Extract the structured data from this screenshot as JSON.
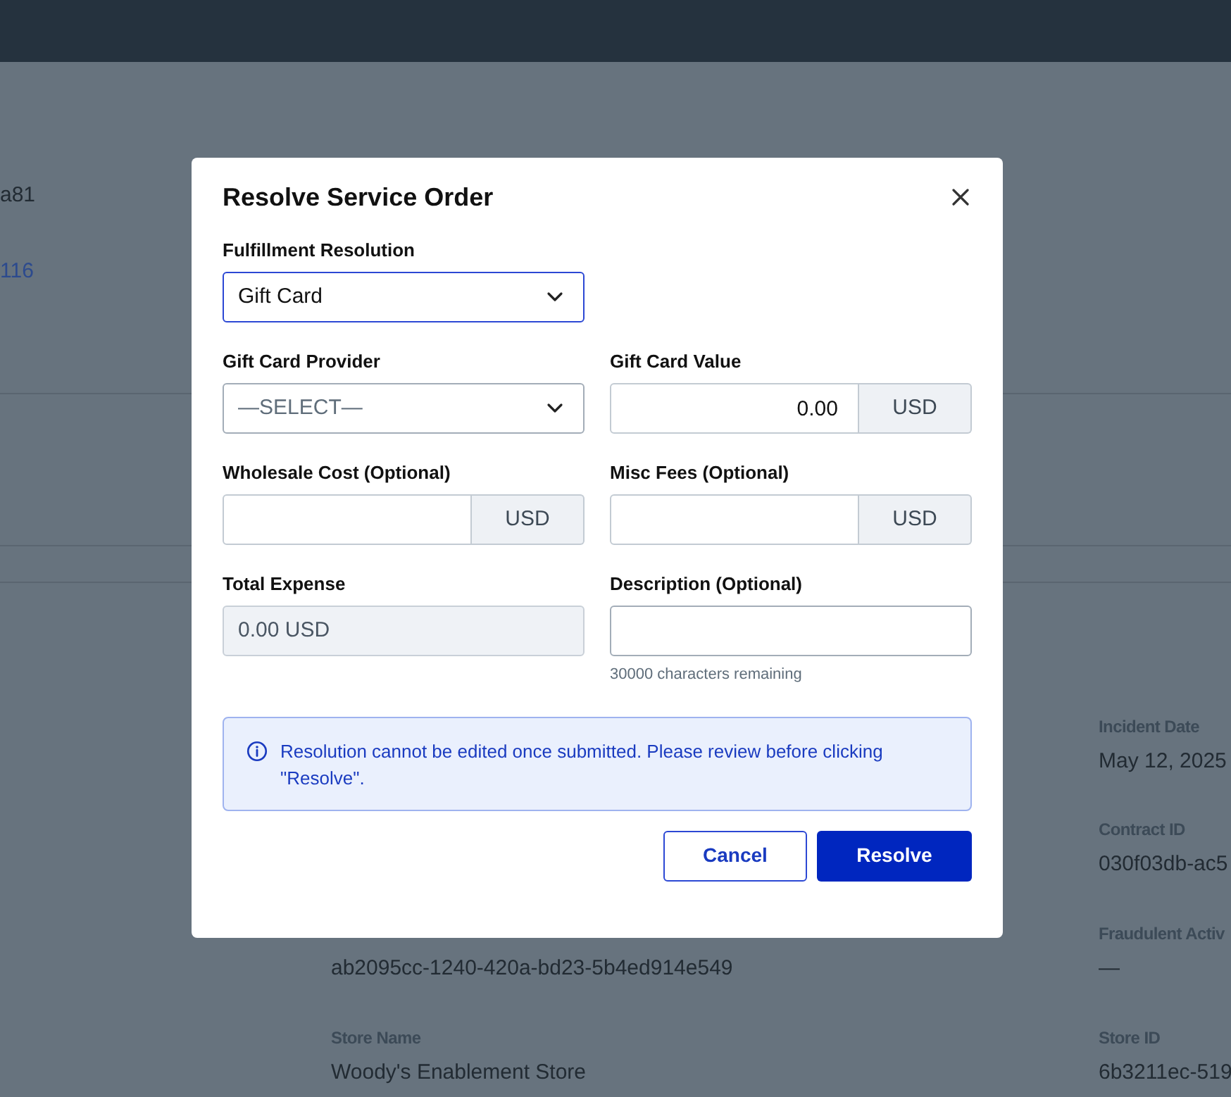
{
  "background": {
    "fragments": [
      {
        "kind": "value",
        "text": "a81"
      },
      {
        "kind": "link",
        "text": "116"
      },
      {
        "kind": "label",
        "text": "Incident Date"
      },
      {
        "kind": "value",
        "text": "May 12, 2025"
      },
      {
        "kind": "label",
        "text": "Contract ID"
      },
      {
        "kind": "value",
        "text": "030f03db-ac5"
      },
      {
        "kind": "label",
        "text": "Fraudulent Activ"
      },
      {
        "kind": "value",
        "text": "—"
      },
      {
        "kind": "value",
        "text": "ab2095cc-1240-420a-bd23-5b4ed914e549"
      },
      {
        "kind": "label",
        "text": "Store Name"
      },
      {
        "kind": "value",
        "text": "Woody's Enablement Store"
      },
      {
        "kind": "label",
        "text": "Store ID"
      },
      {
        "kind": "value",
        "text": "6b3211ec-519"
      }
    ]
  },
  "modal": {
    "title": "Resolve Service Order",
    "rows": [
      [
        {
          "kind": "select",
          "label": "Fulfillment Resolution",
          "value": "Gift Card",
          "focused": true
        }
      ],
      [
        {
          "kind": "select",
          "label": "Gift Card Provider",
          "placeholder": "—SELECT—",
          "focused": false
        },
        {
          "kind": "amount",
          "label": "Gift Card Value",
          "value": "0.00",
          "suffix": "USD"
        }
      ],
      [
        {
          "kind": "amount",
          "label": "Wholesale Cost (Optional)",
          "suffix": "USD"
        },
        {
          "kind": "amount",
          "label": "Misc Fees (Optional)",
          "suffix": "USD"
        }
      ],
      [
        {
          "kind": "readonly",
          "label": "Total Expense",
          "value": "0.00 USD"
        },
        {
          "kind": "text",
          "label": "Description (Optional)",
          "helper": "30000 characters remaining"
        }
      ]
    ],
    "alert": "Resolution cannot be edited once submitted. Please review before clicking \"Resolve\".",
    "buttons": [
      {
        "kind": "secondary",
        "label": "Cancel"
      },
      {
        "kind": "primary",
        "label": "Resolve"
      }
    ]
  }
}
